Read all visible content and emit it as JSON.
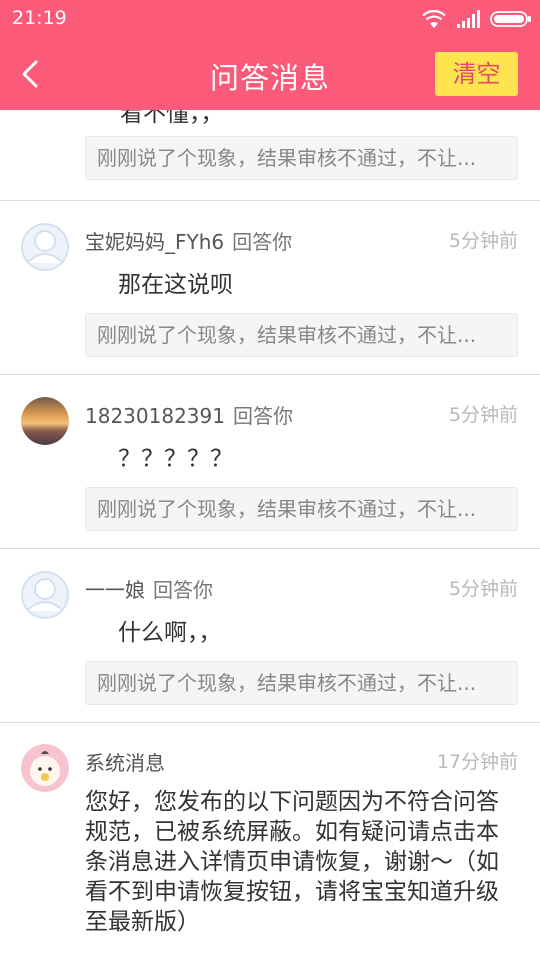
{
  "statusbar": {
    "time": "21:19"
  },
  "header": {
    "title": "问答消息",
    "clear_label": "清空"
  },
  "partial_item": {
    "answer": "看不懂，，",
    "quote": "刚刚说了个现象，结果审核不通过，不让..."
  },
  "items": [
    {
      "user": "宝妮妈妈_FYh6",
      "action": "回答你",
      "time": "5分钟前",
      "answer": "那在这说呗",
      "quote": "刚刚说了个现象，结果审核不通过，不让...",
      "avatar": "default-avatar"
    },
    {
      "user": "18230182391",
      "action": "回答你",
      "time": "5分钟前",
      "answer": "？？？？？",
      "quote": "刚刚说了个现象，结果审核不通过，不让...",
      "avatar": "sunset-photo-avatar"
    },
    {
      "user": "一一娘",
      "action": "回答你",
      "time": "5分钟前",
      "answer": "什么啊，，",
      "quote": "刚刚说了个现象，结果审核不通过，不让...",
      "avatar": "default-avatar"
    }
  ],
  "system_message": {
    "sender": "系统消息",
    "time": "17分钟前",
    "text": "您好，您发布的以下问题因为不符合问答规范，已被系统屏蔽。如有疑问请点击本条消息进入详情页申请恢复，谢谢～（如看不到申请恢复按钮，请将宝宝知道升级至最新版）"
  },
  "colors": {
    "header": "#fb5a79",
    "clear_button": "#fee54f",
    "clear_text": "#e7476a"
  }
}
